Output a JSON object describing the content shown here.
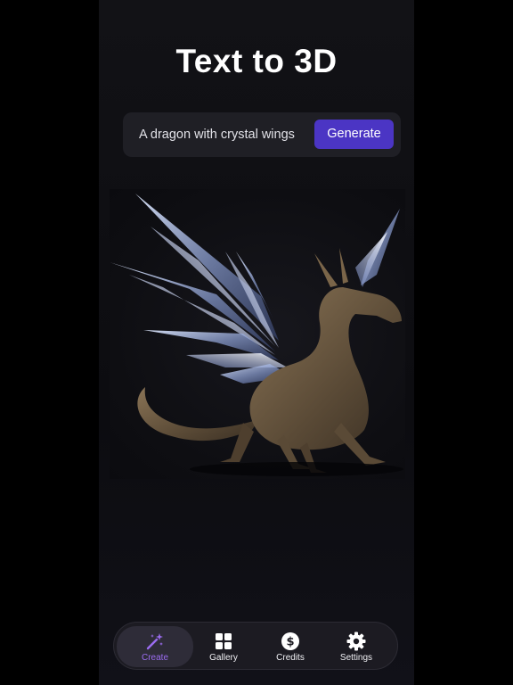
{
  "page": {
    "title": "Text to 3D"
  },
  "prompt": {
    "value": "A dragon with crystal wings",
    "generate_label": "Generate"
  },
  "preview": {
    "subject_icon": "dragon-with-crystal-wings-render"
  },
  "tabbar": {
    "active": "Create",
    "accent_color": "#9b6cf0",
    "items": [
      {
        "label": "Create",
        "icon": "magic-wand-icon"
      },
      {
        "label": "Gallery",
        "icon": "grid-icon"
      },
      {
        "label": "Credits",
        "icon": "dollar-coin-icon"
      },
      {
        "label": "Settings",
        "icon": "gear-icon"
      }
    ]
  },
  "colors": {
    "background": "#0c0c10",
    "button": "#4b35c4",
    "tabbar": "#1c1b22"
  }
}
